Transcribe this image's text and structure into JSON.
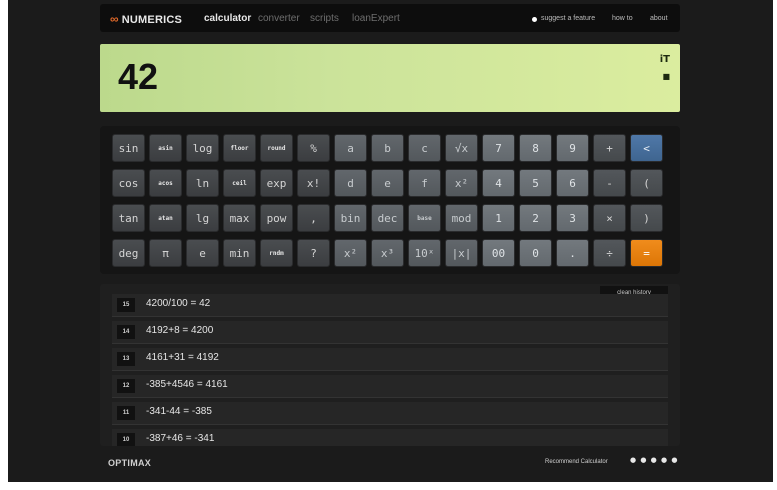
{
  "nav": {
    "logo_text": "NUMERICS",
    "logo_icon": "infinity-icon",
    "tabs": [
      "calculator",
      "converter",
      "scripts",
      "loanExpert"
    ],
    "active_tab": "calculator",
    "right_links": [
      "suggest a feature",
      "how to",
      "about"
    ]
  },
  "display": {
    "value": "42",
    "indicator_top": "iT",
    "indicator_bottom": "■"
  },
  "keypad": {
    "rows": [
      [
        "sin",
        "asin",
        "log",
        "floor",
        "round",
        "%",
        "a",
        "b",
        "c",
        "√x",
        "7",
        "8",
        "9",
        "+",
        "<"
      ],
      [
        "cos",
        "acos",
        "ln",
        "ceil",
        "exp",
        "x!",
        "d",
        "e",
        "f",
        "x²",
        "4",
        "5",
        "6",
        "-",
        "("
      ],
      [
        "tan",
        "atan",
        "lg",
        "max",
        "pow",
        ",",
        "bin",
        "dec",
        "base",
        "mod",
        "1",
        "2",
        "3",
        "×",
        ")"
      ],
      [
        "deg",
        "π",
        "e",
        "min",
        "rndm",
        "?",
        "x²",
        "x³",
        "10ˣ",
        "|x|",
        "00",
        "0",
        ".",
        "÷",
        "="
      ]
    ],
    "accent_blue": "#4f78a8",
    "accent_orange": "#f08c1c"
  },
  "history": {
    "clear_label": "clean history",
    "entries": [
      {
        "n": "15",
        "expr": "4200/100 = 42"
      },
      {
        "n": "14",
        "expr": "4192+8 = 4200"
      },
      {
        "n": "13",
        "expr": "4161+31 = 4192"
      },
      {
        "n": "12",
        "expr": "-385+4546 = 4161"
      },
      {
        "n": "11",
        "expr": "-341-44 = -385"
      },
      {
        "n": "10",
        "expr": "-387+46 = -341"
      }
    ]
  },
  "footer": {
    "brand": "OPTIMAX",
    "recommend_label": "Recommend Calculator",
    "stars": "● ● ● ● ●"
  }
}
